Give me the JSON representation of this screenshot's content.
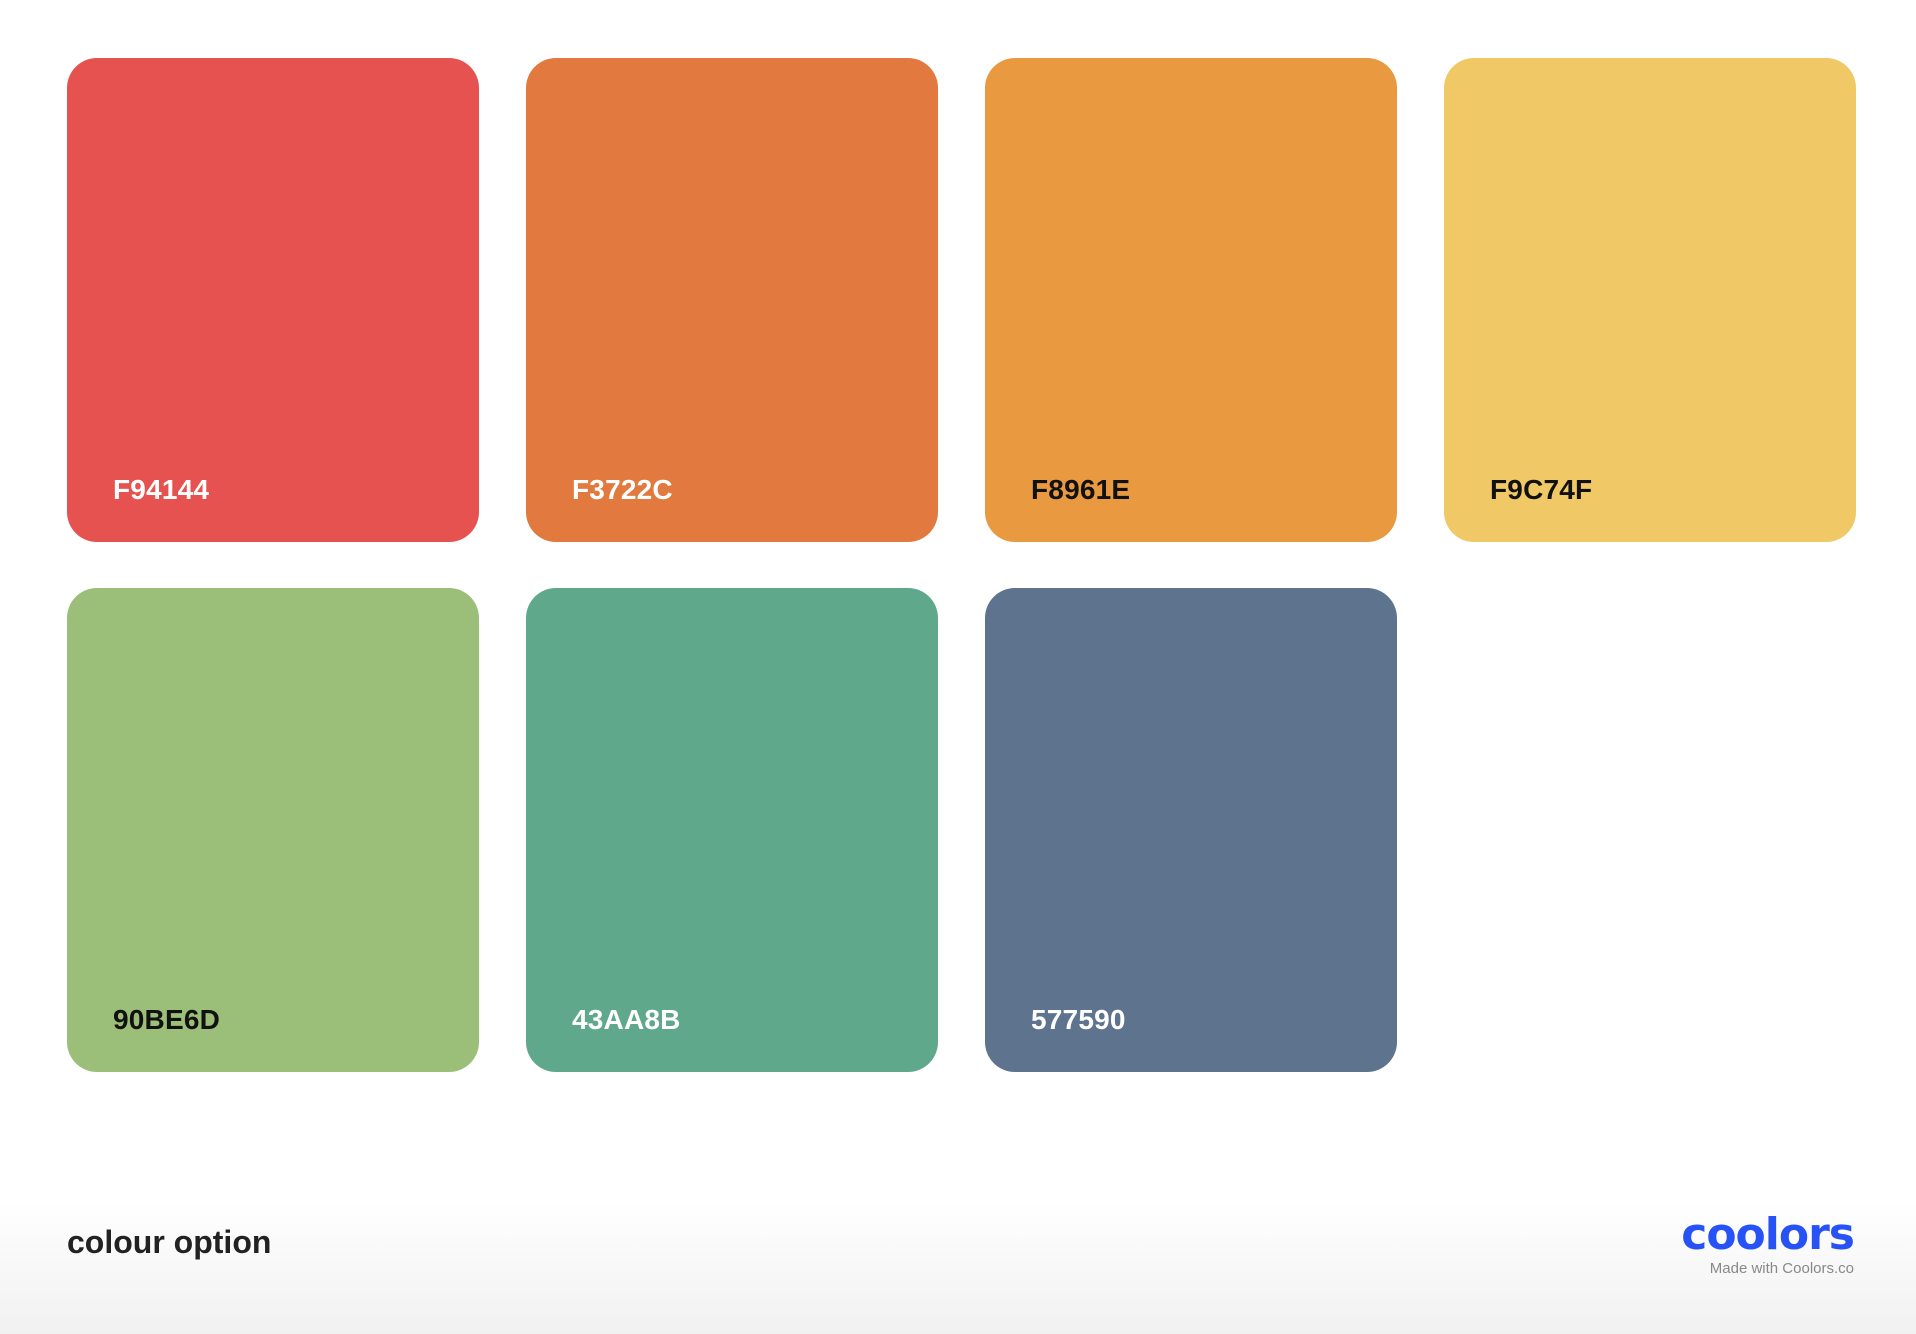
{
  "palette": {
    "name": "colour option",
    "swatches": [
      {
        "hex": "F94144",
        "display": "#E65250",
        "text_color": "#ffffff"
      },
      {
        "hex": "F3722C",
        "display": "#E2793E",
        "text_color": "#ffffff"
      },
      {
        "hex": "F8961E",
        "display": "#E99A40",
        "text_color": "#111111"
      },
      {
        "hex": "F9C74F",
        "display": "#F0C865",
        "text_color": "#111111"
      },
      {
        "hex": "90BE6D",
        "display": "#9BBE78",
        "text_color": "#111111"
      },
      {
        "hex": "43AA8B",
        "display": "#60A88C",
        "text_color": "#ffffff"
      },
      {
        "hex": "577590",
        "display": "#5E738D",
        "text_color": "#ffffff"
      }
    ]
  },
  "brand": {
    "logo_text": "coolors",
    "logo_color": "#2752F6",
    "credit": "Made with Coolors.co"
  }
}
